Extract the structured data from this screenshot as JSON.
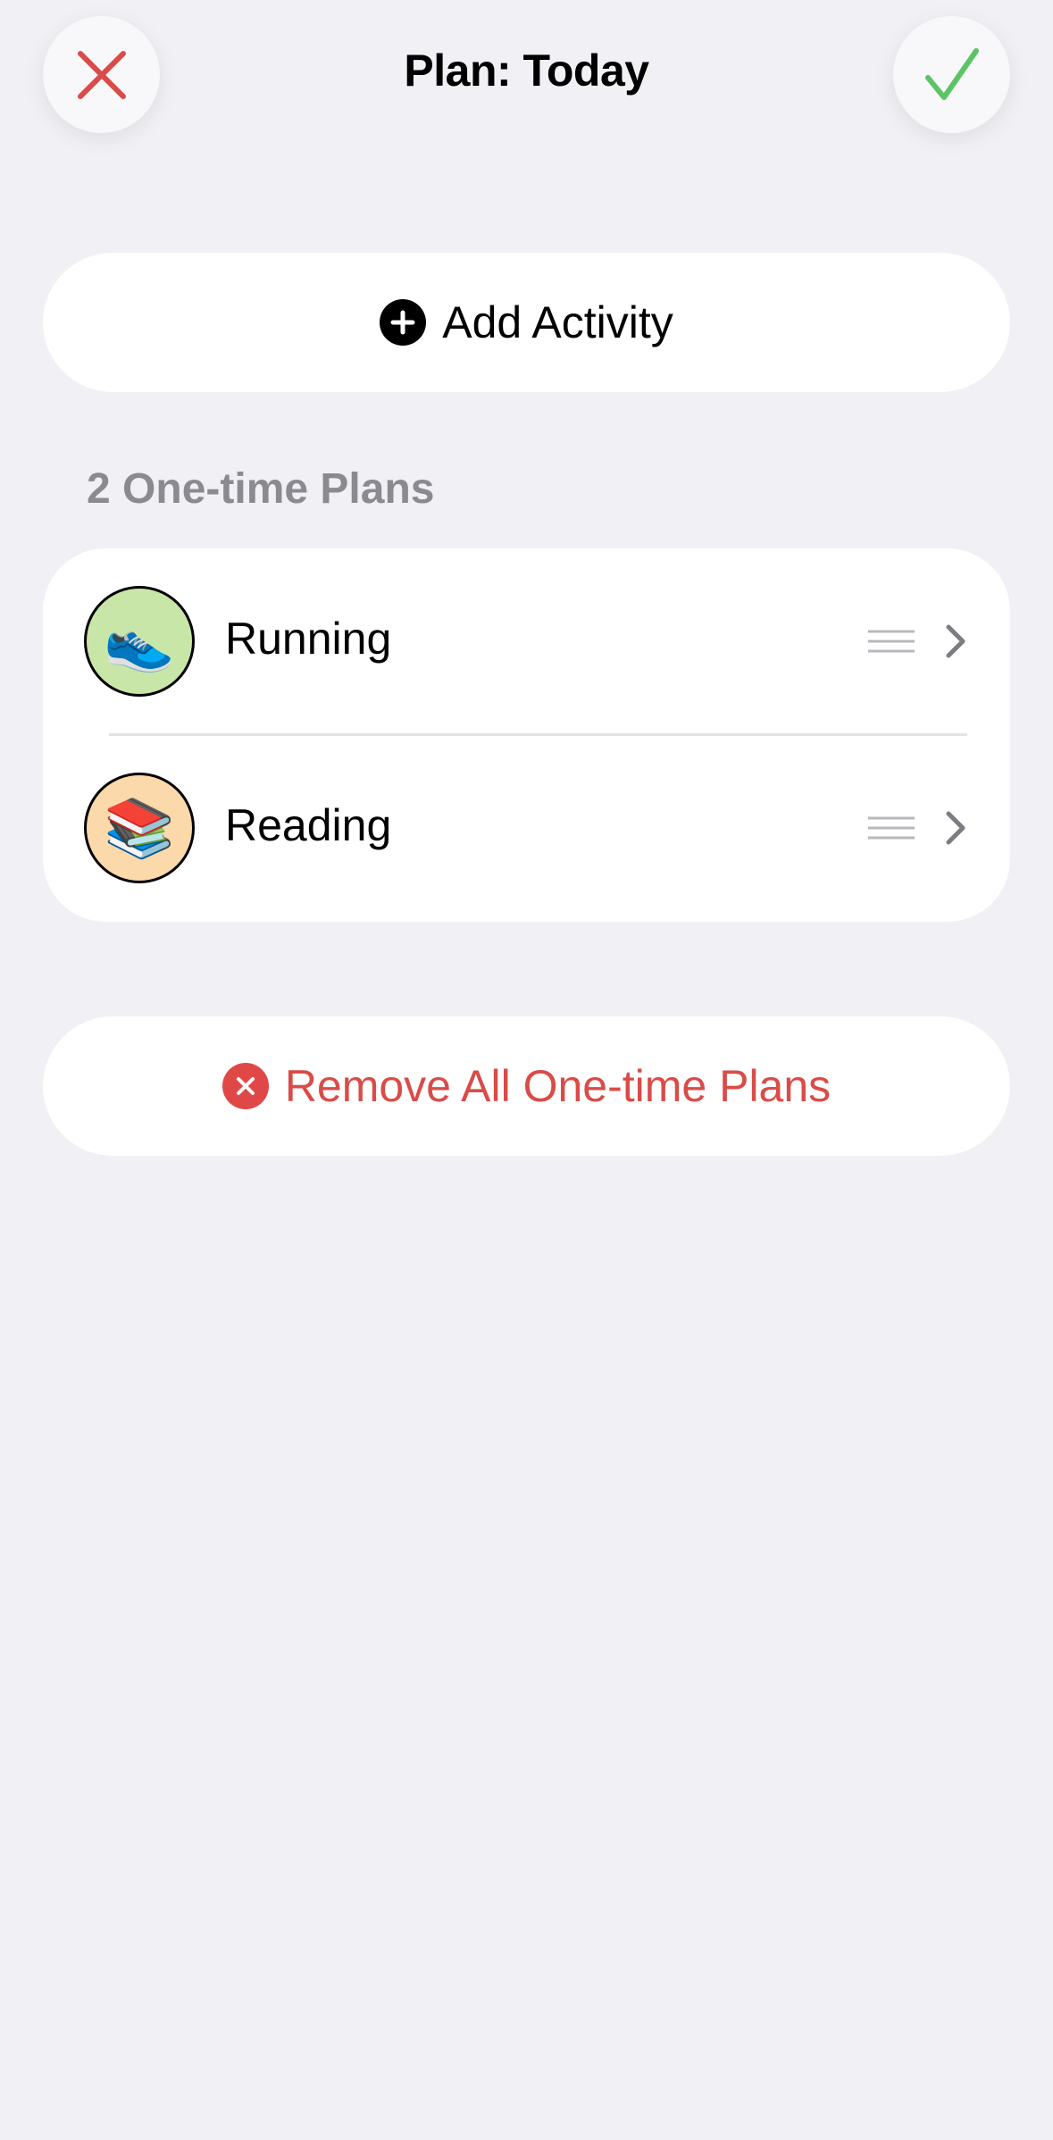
{
  "header": {
    "title": "Plan: Today",
    "close_icon": "close-x-icon",
    "confirm_icon": "checkmark-icon"
  },
  "add_activity": {
    "label": "Add Activity",
    "icon": "plus-circle-icon"
  },
  "plans": {
    "section_title": "2 One-time Plans",
    "items": [
      {
        "label": "Running",
        "emoji": "👟",
        "icon": "sneaker-icon",
        "avatar_color": "#c9e6a9"
      },
      {
        "label": "Reading",
        "emoji": "📚",
        "icon": "books-icon",
        "avatar_color": "#fbd9ab"
      }
    ]
  },
  "remove_all": {
    "label": "Remove All One-time Plans",
    "icon": "x-circle-icon"
  },
  "colors": {
    "background": "#f0f0f5",
    "danger": "#d94c48",
    "confirm": "#5cc465",
    "secondary_text": "#8a8a90"
  }
}
